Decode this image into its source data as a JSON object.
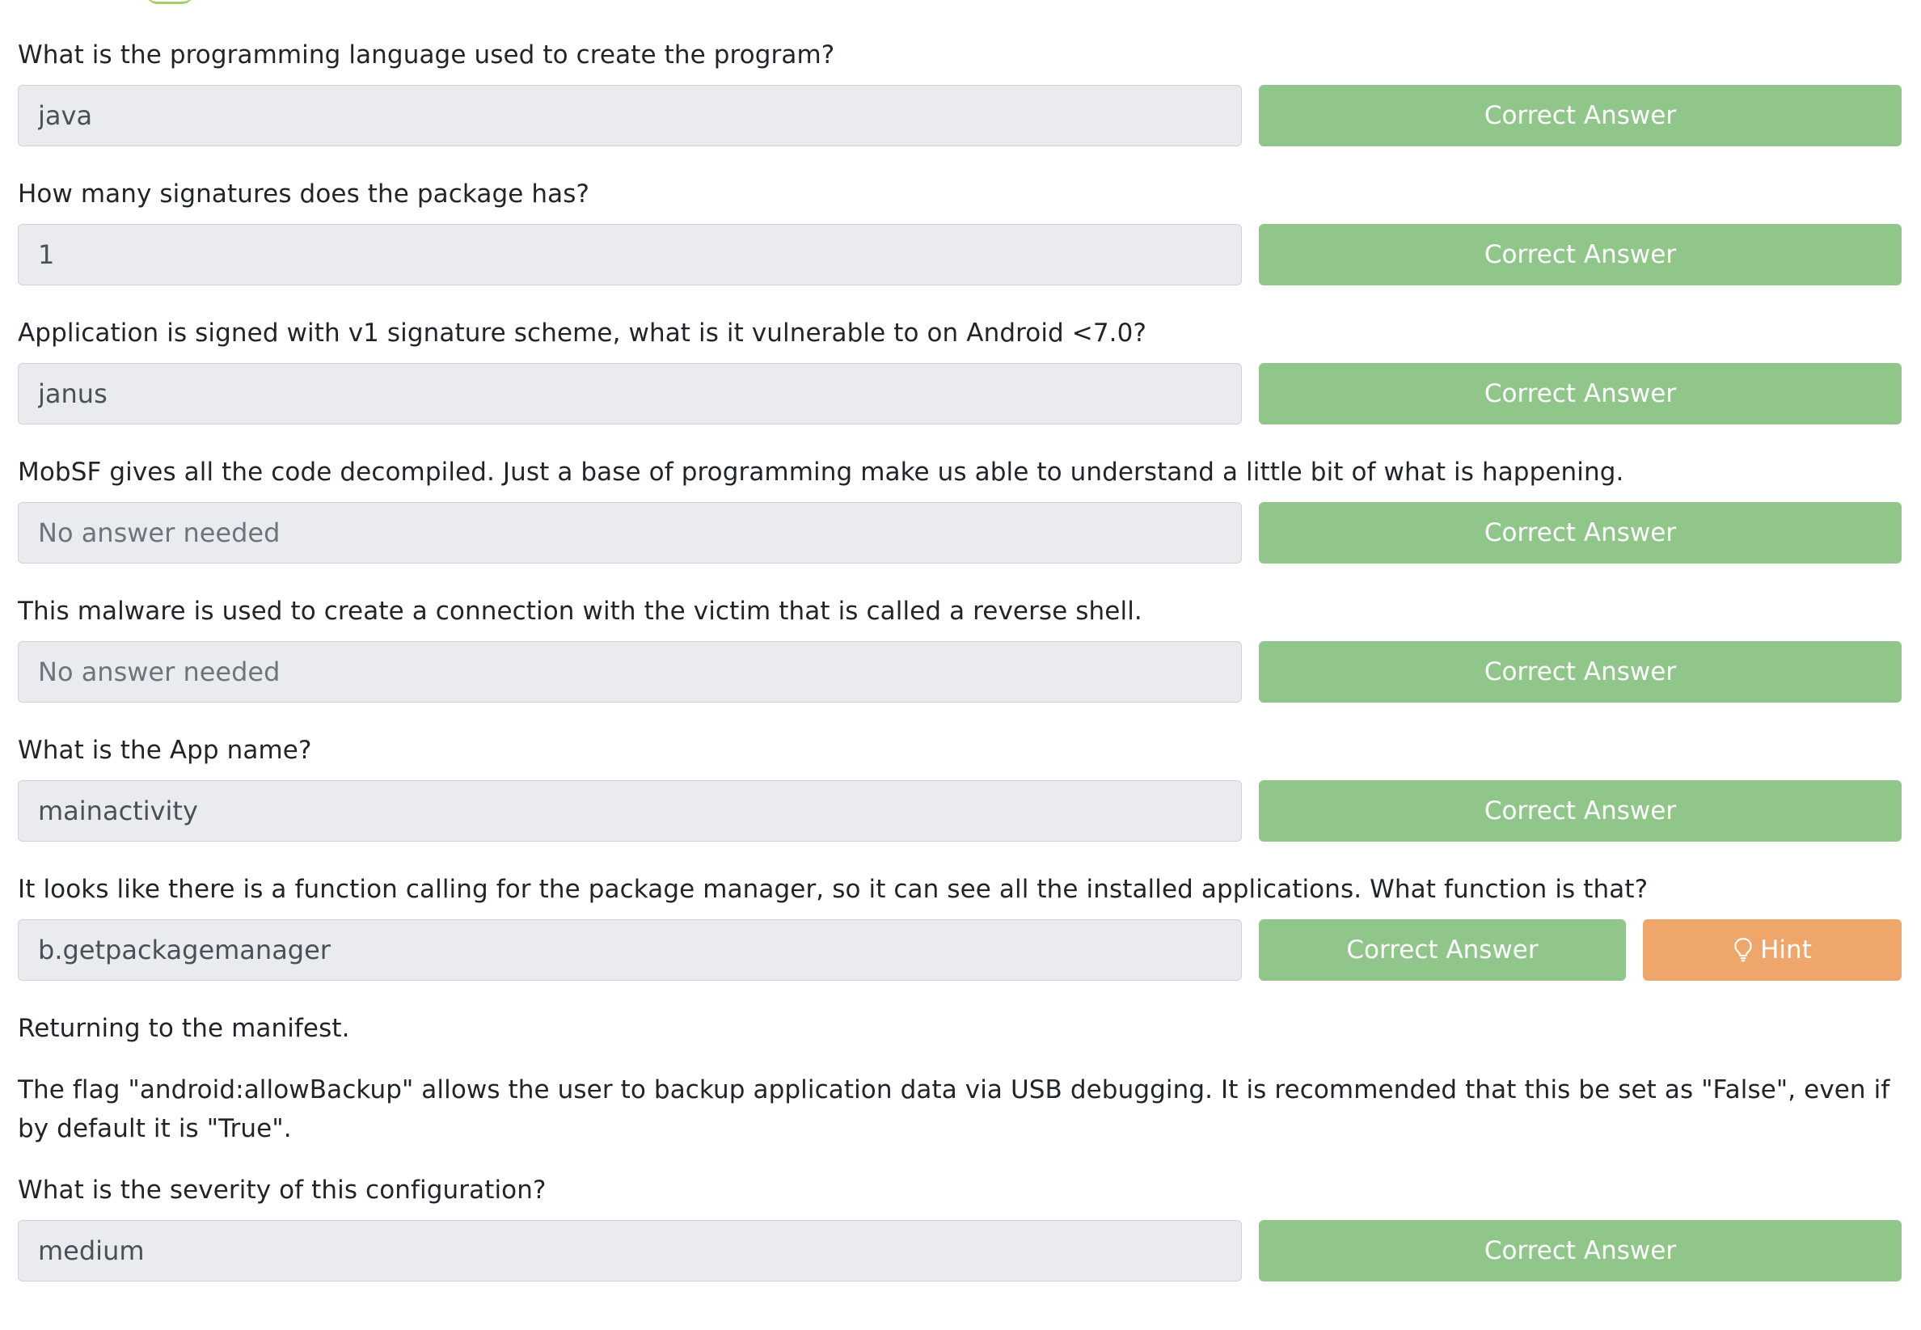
{
  "questions": [
    {
      "prompt": "What is the programming language used to create the program?",
      "answer": "java",
      "placeholder": "",
      "button": "Correct Answer"
    },
    {
      "prompt": "How many signatures does the package has?",
      "answer": "1",
      "placeholder": "",
      "button": "Correct Answer"
    },
    {
      "prompt": "Application is signed with v1 signature scheme, what is it vulnerable to on Android <7.0?",
      "answer": "janus",
      "placeholder": "",
      "button": "Correct Answer"
    },
    {
      "prompt": "MobSF gives all the code decompiled. Just a base of programming make us able to understand a little bit of what is happening.",
      "answer": "",
      "placeholder": "No answer needed",
      "button": "Correct Answer"
    },
    {
      "prompt": "This malware is used to create a connection with the victim that is called a reverse shell.",
      "answer": "",
      "placeholder": "No answer needed",
      "button": "Correct Answer"
    },
    {
      "prompt": "What is the App name?",
      "answer": "mainactivity",
      "placeholder": "",
      "button": "Correct Answer"
    },
    {
      "prompt": "It looks like  there is a function calling for the package manager, so it can see all the installed applications. What function is that?",
      "answer": "b.getpackagemanager",
      "placeholder": "",
      "button": "Correct Answer",
      "hint": "Hint"
    },
    {
      "intro_1": "Returning to the manifest.",
      "intro_2": "The flag \"android:allowBackup\" allows the user to backup application data via USB debugging. It is recommended that this be set as \"False\", even if by default it is \"True\".",
      "prompt": "What is the severity of this configuration?",
      "answer": "medium",
      "placeholder": "",
      "button": "Correct Answer"
    }
  ],
  "colors": {
    "correct_button": "#90c68a",
    "hint_button": "#efa66a",
    "input_background": "#e9ebef"
  },
  "icons": {
    "hint": "lightbulb-icon"
  }
}
